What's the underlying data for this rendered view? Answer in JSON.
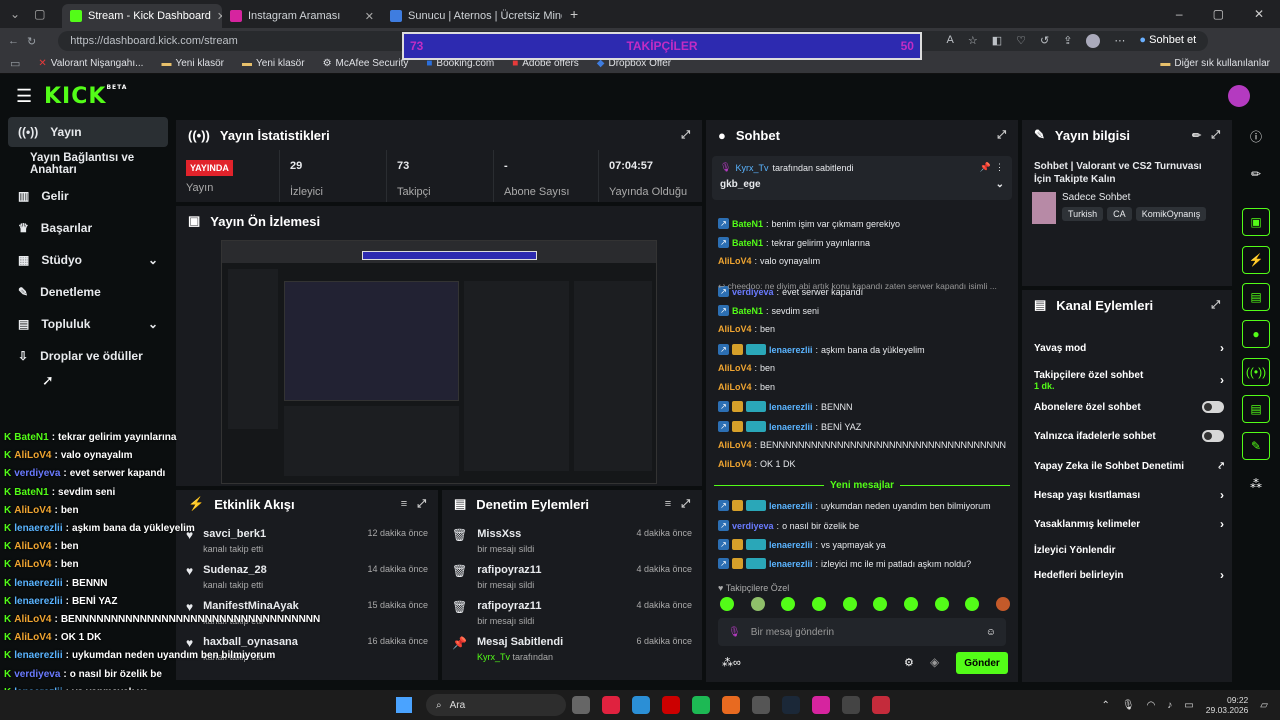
{
  "browser": {
    "tabs": [
      {
        "label": "Stream - Kick Dashboard",
        "color": "#53fc18",
        "active": true
      },
      {
        "label": "Instagram Araması",
        "color": "#d6249f",
        "active": false
      },
      {
        "label": "Sunucu | Aternos | Ücretsiz Minecr",
        "color": "#3f7de0",
        "active": false
      }
    ],
    "url": "https://dashboard.kick.com/stream",
    "bookmarks": [
      "Valorant Nişangahı...",
      "Yeni klasör",
      "Yeni klasör",
      "McAfee Security",
      "Booking.com",
      "Adobe offers",
      "Dropbox Offer"
    ],
    "other_bookmarks": "Diğer sık kullanılanlar",
    "chat_button": "Sohbet et"
  },
  "overlay": {
    "follower_left": "73",
    "follower_title": "TAKİPÇİLER",
    "follower_right": "50",
    "chat": [
      {
        "user": "BateN1",
        "color": "#53fc18",
        "msg": "tekrar gelirim yayınlarına"
      },
      {
        "user": "AliLoV4",
        "color": "#f0a531",
        "msg": "valo oynayalım"
      },
      {
        "user": "verdiyeva",
        "color": "#6a7bff",
        "msg": "evet serwer kapandı"
      },
      {
        "user": "BateN1",
        "color": "#53fc18",
        "msg": "sevdim seni"
      },
      {
        "user": "AliLoV4",
        "color": "#f0a531",
        "msg": "ben"
      },
      {
        "user": "lenaerezlii",
        "color": "#5ab4ff",
        "msg": "aşkım bana da yükleyelim"
      },
      {
        "user": "AliLoV4",
        "color": "#f0a531",
        "msg": "ben"
      },
      {
        "user": "AliLoV4",
        "color": "#f0a531",
        "msg": "ben"
      },
      {
        "user": "lenaerezlii",
        "color": "#5ab4ff",
        "msg": "BENNN"
      },
      {
        "user": "lenaerezlii",
        "color": "#5ab4ff",
        "msg": "BENİ YAZ"
      },
      {
        "user": "AliLoV4",
        "color": "#f0a531",
        "msg": "BENNNNNNNNNNNNNNNNNNNNNNNNNNNNNNNNNN"
      },
      {
        "user": "AliLoV4",
        "color": "#f0a531",
        "msg": "OK 1 DK"
      },
      {
        "user": "lenaerezlii",
        "color": "#5ab4ff",
        "msg": "uykumdan neden uyandım ben bilmiyorum"
      },
      {
        "user": "verdiyeva",
        "color": "#6a7bff",
        "msg": "o nasıl bir özelik be"
      },
      {
        "user": "lenaerezlii",
        "color": "#5ab4ff",
        "msg": "vs yapmayak ya"
      },
      {
        "user": "lenaerezlii",
        "color": "#5ab4ff",
        "msg": "izleyici mc ile mi patladı aşkım noldu?"
      }
    ]
  },
  "kick": {
    "logo": "KICK",
    "logo_sup": "BETA",
    "sidebar": [
      {
        "label": "Yayın",
        "icon": "broadcast-icon",
        "active": true
      },
      {
        "label": "Yayın Bağlantısı ve Anahtarı",
        "icon": "",
        "active": false
      },
      {
        "label": "Gelir",
        "icon": "chart-icon",
        "active": false
      },
      {
        "label": "Başarılar",
        "icon": "trophy-icon",
        "active": false
      },
      {
        "label": "Stüdyo",
        "icon": "studio-icon",
        "active": false,
        "chevron": true
      },
      {
        "label": "Denetleme",
        "icon": "wrench-icon",
        "active": false
      },
      {
        "label": "Topluluk",
        "icon": "community-icon",
        "active": false,
        "chevron": true
      },
      {
        "label": "Droplar ve ödüller",
        "icon": "drops-icon",
        "active": false
      }
    ],
    "stats": {
      "title": "Yayın İstatistikleri",
      "live_badge": "YAYINDA",
      "live_label": "Yayın",
      "items": [
        {
          "value": "29",
          "label": "İzleyici"
        },
        {
          "value": "73",
          "label": "Takipçi"
        },
        {
          "value": "-",
          "label": "Abone Sayısı"
        },
        {
          "value": "07:04:57",
          "label": "Yayında Olduğu"
        }
      ]
    },
    "preview": {
      "title": "Yayın Ön İzlemesi"
    },
    "activity": {
      "title": "Etkinlik Akışı",
      "items": [
        {
          "name": "savci_berk1",
          "sub": "kanalı takip etti",
          "time": "12 dakika önce"
        },
        {
          "name": "Sudenaz_28",
          "sub": "kanalı takip etti",
          "time": "14 dakika önce"
        },
        {
          "name": "ManifestMinaAyak",
          "sub": "kanalı takip etti",
          "time": "15 dakika önce"
        },
        {
          "name": "haxball_oynasana",
          "sub": "kanalı takip etti",
          "time": "16 dakika önce"
        }
      ]
    },
    "moderation": {
      "title": "Denetim Eylemleri",
      "items": [
        {
          "name": "MissXss",
          "sub": "bir mesajı sildi",
          "time": "4 dakika önce"
        },
        {
          "name": "rafipoyraz11",
          "sub": "bir mesajı sildi",
          "time": "4 dakika önce"
        },
        {
          "name": "rafipoyraz11",
          "sub": "bir mesajı sildi",
          "time": "4 dakika önce"
        },
        {
          "name": "Mesaj Sabitlendi",
          "sub": "tarafından",
          "sub_user": "Kyrx_Tv",
          "time": "6 dakika önce"
        }
      ]
    },
    "chat": {
      "title": "Sohbet",
      "pinned_by_user": "Kyrx_Tv",
      "pinned_by_text": "tarafından sabitlendi",
      "pinned_msg": "gkb_ege",
      "reply_line": "cheedoo: ne diyim abi artık konu kapandı zaten serwer kapandı isimli ...",
      "messages": [
        {
          "user": "BateN1",
          "color": "#53fc18",
          "msg": "benim işim var çıkmam gerekiyo",
          "badge": "k"
        },
        {
          "user": "BateN1",
          "color": "#53fc18",
          "msg": "tekrar gelirim yayınlarına",
          "badge": "k"
        },
        {
          "user": "AliLoV4",
          "color": "#f0a531",
          "msg": "valo oynayalım",
          "badge": ""
        },
        {
          "user": "verdiyeva",
          "color": "#6a7bff",
          "msg": "evet serwer kapandı",
          "badge": "k"
        },
        {
          "user": "BateN1",
          "color": "#53fc18",
          "msg": "sevdim seni",
          "badge": "k"
        },
        {
          "user": "AliLoV4",
          "color": "#f0a531",
          "msg": "ben",
          "badge": ""
        },
        {
          "user": "lenaerezlii",
          "color": "#5ab4ff",
          "msg": "aşkım bana da yükleyelim",
          "badge": "full"
        },
        {
          "user": "AliLoV4",
          "color": "#f0a531",
          "msg": "ben",
          "badge": ""
        },
        {
          "user": "AliLoV4",
          "color": "#f0a531",
          "msg": "ben",
          "badge": ""
        },
        {
          "user": "lenaerezlii",
          "color": "#5ab4ff",
          "msg": "BENNN",
          "badge": "full"
        },
        {
          "user": "lenaerezlii",
          "color": "#5ab4ff",
          "msg": "BENİ YAZ",
          "badge": "full"
        },
        {
          "user": "AliLoV4",
          "color": "#f0a531",
          "msg": "BENNNNNNNNNNNNNNNNNNNNNNNNNNNNNNNNNNNN",
          "badge": ""
        },
        {
          "user": "AliLoV4",
          "color": "#f0a531",
          "msg": "OK 1 DK",
          "badge": ""
        }
      ],
      "new_messages": "Yeni mesajlar",
      "messages2": [
        {
          "user": "lenaerezlii",
          "color": "#5ab4ff",
          "msg": "uykumdan neden uyandım ben bilmiyorum",
          "badge": "full"
        },
        {
          "user": "verdiyeva",
          "color": "#6a7bff",
          "msg": "o nasıl bir özelik be",
          "badge": "k"
        },
        {
          "user": "lenaerezlii",
          "color": "#5ab4ff",
          "msg": "vs yapmayak ya",
          "badge": "full"
        },
        {
          "user": "lenaerezlii",
          "color": "#5ab4ff",
          "msg": "izleyici mc ile mi patladı aşkım noldu?",
          "badge": "full"
        }
      ],
      "followers_only": "Takipçilere Özel",
      "input_placeholder": "Bir mesaj gönderin",
      "send_label": "Gönder"
    },
    "info": {
      "title": "Yayın bilgisi",
      "stream_title": "Sohbet | Valorant ve CS2 Turnuvası İçin Takipte Kalın",
      "category": "Sadece Sohbet",
      "tags": [
        "Turkish",
        "CA",
        "KomikOynanış"
      ]
    },
    "actions": {
      "title": "Kanal Eylemleri",
      "rows": [
        {
          "label": "Yavaş mod",
          "type": "chevron"
        },
        {
          "label": "Takipçilere özel sohbet",
          "sub": "1 dk.",
          "type": "chevron"
        },
        {
          "label": "Abonelere özel sohbet",
          "type": "toggle"
        },
        {
          "label": "Yalnızca ifadelerle sohbet",
          "type": "toggle"
        },
        {
          "label": "Yapay Zeka ile Sohbet Denetimi",
          "type": "external"
        },
        {
          "label": "Hesap yaşı kısıtlaması",
          "type": "chevron"
        },
        {
          "label": "Yasaklanmış kelimeler",
          "type": "chevron"
        },
        {
          "label": "İzleyici Yönlendir",
          "type": "none"
        },
        {
          "label": "Hedefleri belirleyin",
          "type": "chevron"
        }
      ]
    }
  },
  "taskbar": {
    "search": "Ara",
    "time": "09:22",
    "date": "29.03.2026"
  }
}
